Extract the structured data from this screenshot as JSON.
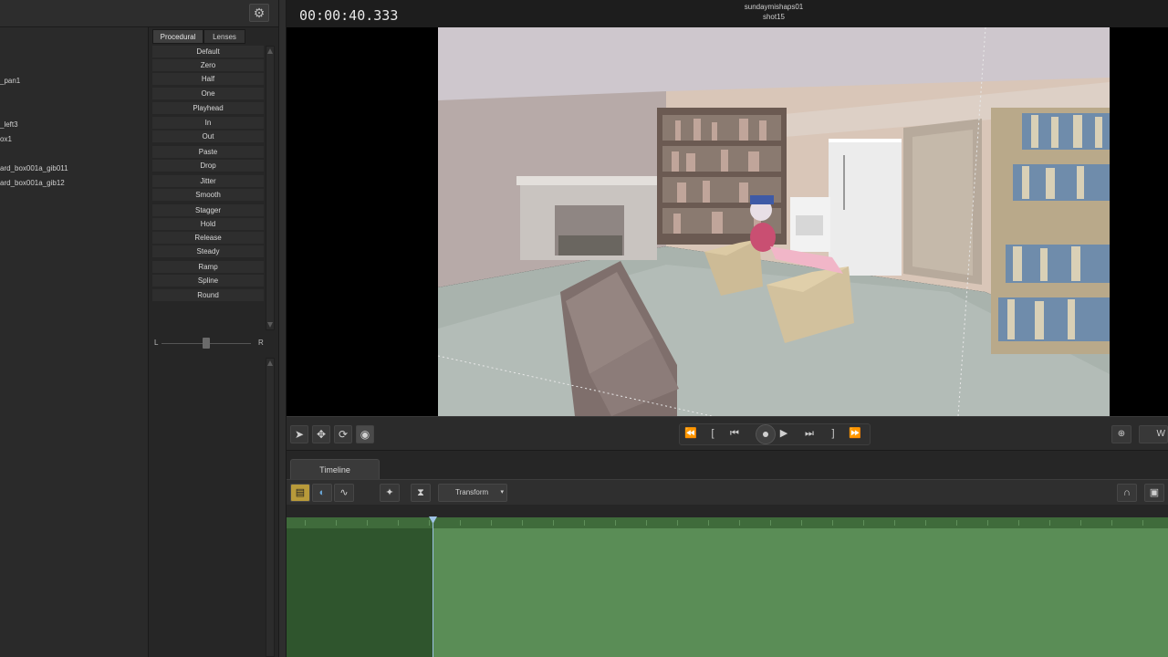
{
  "header": {
    "timecode": "00:00:40.333",
    "session_name": "sundaymishaps01",
    "shot_name": "shot15"
  },
  "animset_tree": {
    "items": [
      {
        "label": "_pan1"
      },
      {
        "label": "_left3"
      },
      {
        "label": "ox1"
      },
      {
        "label": "ard_box001a_gib011"
      },
      {
        "label": "ard_box001a_gib12"
      }
    ]
  },
  "procedural_panel": {
    "tabs": [
      "Procedural",
      "Lenses"
    ],
    "active_tab": "Procedural",
    "presets": [
      "Default",
      "Zero",
      "Half",
      "One",
      "Playhead",
      "In",
      "Out",
      "Paste",
      "Drop",
      "Jitter",
      "Smooth",
      "Stagger",
      "Hold",
      "Release",
      "Steady",
      "Ramp",
      "Spline",
      "Round"
    ],
    "balance": {
      "left_label": "L",
      "right_label": "R",
      "value": 0.5
    }
  },
  "transport": {
    "right_button_label": "W"
  },
  "timeline": {
    "tab_label": "Timeline",
    "mode_dropdown": "Transform",
    "playhead_fraction": 0.166
  },
  "icons": {
    "settings": "gear-icon",
    "select": "pointer-icon",
    "move": "move-icon",
    "rotate": "rotate-icon",
    "pivot": "pivot-icon",
    "rewind": "rewind-icon",
    "mark_in": "mark-in-icon",
    "prev_frame": "step-back-icon",
    "record": "record-icon",
    "play": "play-icon",
    "next_frame": "step-forward-icon",
    "mark_out": "mark-out-icon",
    "fast_forward": "fast-forward-icon",
    "camera_target": "target-icon",
    "magnet": "magnet-icon"
  },
  "colors": {
    "timeline_green": "#5a8d56",
    "timeline_dark": "#2f552d",
    "playhead": "#9fc3e6",
    "accent": "#b89a3a"
  }
}
